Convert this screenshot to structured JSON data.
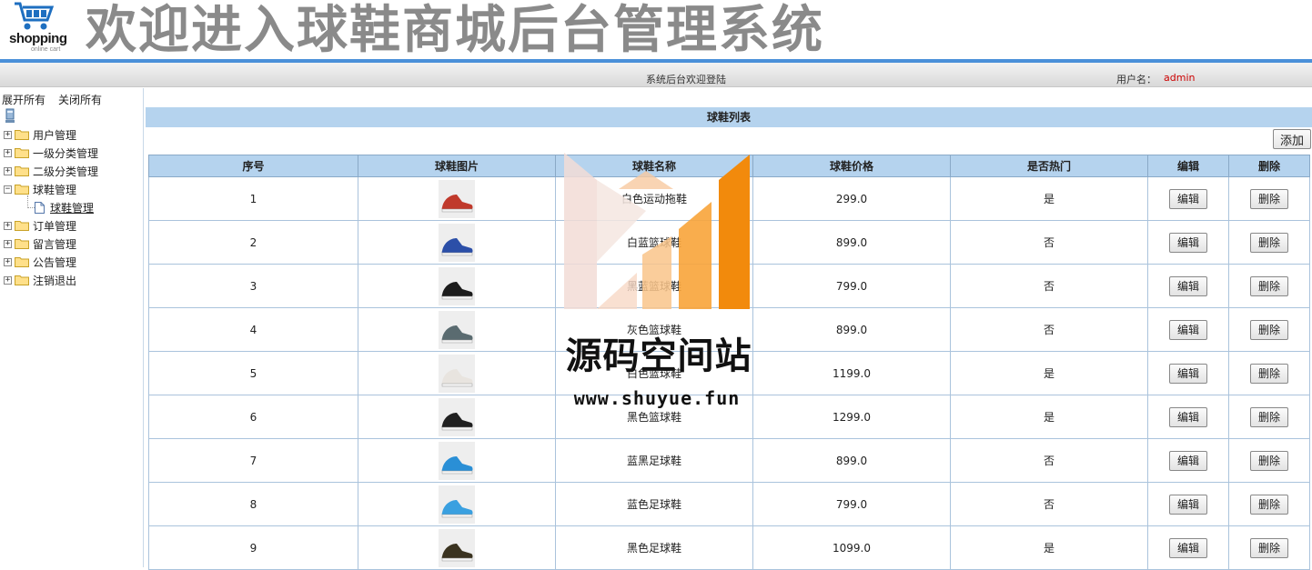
{
  "header": {
    "logo_text": "shopping",
    "logo_sub": "online cart",
    "title": "欢迎进入球鞋商城后台管理系统"
  },
  "welcome_bar": {
    "text": "系统后台欢迎登陆",
    "user_label": "用户名：",
    "user_name": "admin"
  },
  "sidebar": {
    "expand_all": "展开所有",
    "collapse_all": "关闭所有",
    "items": [
      {
        "label": "用户管理",
        "expanded": false
      },
      {
        "label": "一级分类管理",
        "expanded": false
      },
      {
        "label": "二级分类管理",
        "expanded": false
      },
      {
        "label": "球鞋管理",
        "expanded": true
      },
      {
        "label": "订单管理",
        "expanded": false
      },
      {
        "label": "留言管理",
        "expanded": false
      },
      {
        "label": "公告管理",
        "expanded": false
      },
      {
        "label": "注销退出",
        "expanded": false
      }
    ],
    "sub_item": "球鞋管理"
  },
  "main": {
    "list_title": "球鞋列表",
    "add_label": "添加",
    "columns": [
      "序号",
      "球鞋图片",
      "球鞋名称",
      "球鞋价格",
      "是否热门",
      "编辑",
      "删除"
    ],
    "edit_label": "编辑",
    "delete_label": "删除",
    "rows": [
      {
        "no": "1",
        "name": "白色运动拖鞋",
        "price": "299.0",
        "hot": "是",
        "shoe_color": "#c0392b"
      },
      {
        "no": "2",
        "name": "白蓝篮球鞋",
        "price": "899.0",
        "hot": "否",
        "shoe_color": "#2c4fa8"
      },
      {
        "no": "3",
        "name": "黑蓝篮球鞋",
        "price": "799.0",
        "hot": "否",
        "shoe_color": "#1c1c1c"
      },
      {
        "no": "4",
        "name": "灰色篮球鞋",
        "price": "899.0",
        "hot": "否",
        "shoe_color": "#5a6b70"
      },
      {
        "no": "5",
        "name": "白色篮球鞋",
        "price": "1199.0",
        "hot": "是",
        "shoe_color": "#e8e4df"
      },
      {
        "no": "6",
        "name": "黑色篮球鞋",
        "price": "1299.0",
        "hot": "是",
        "shoe_color": "#202020"
      },
      {
        "no": "7",
        "name": "蓝黑足球鞋",
        "price": "899.0",
        "hot": "否",
        "shoe_color": "#2a8fd6"
      },
      {
        "no": "8",
        "name": "蓝色足球鞋",
        "price": "799.0",
        "hot": "否",
        "shoe_color": "#3aa0e0"
      },
      {
        "no": "9",
        "name": "黑色足球鞋",
        "price": "1099.0",
        "hot": "是",
        "shoe_color": "#3a3320"
      }
    ]
  },
  "watermark": {
    "name": "源码空间站",
    "url": "www.shuyue.fun"
  },
  "colors": {
    "accent": "#4a90d9",
    "table_header": "#b5d3ee",
    "user_name": "#cc0000"
  }
}
